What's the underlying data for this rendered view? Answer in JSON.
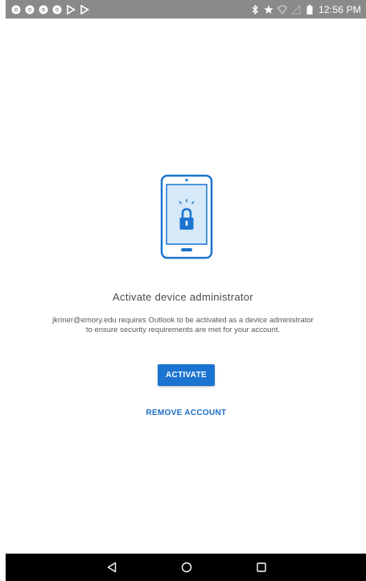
{
  "status_bar": {
    "time": "12:56 PM",
    "notification_icons": [
      "chrome-icon",
      "chrome-icon",
      "chrome-icon",
      "chrome-icon",
      "play-store-icon",
      "play-store-icon"
    ],
    "system_icons": [
      "bluetooth-icon",
      "star-icon",
      "wifi-icon",
      "signal-icon",
      "battery-icon"
    ]
  },
  "main": {
    "title": "Activate device administrator",
    "description_line1": "jkriner@emory.edu requires Outlook to be activated as a device administrator",
    "description_line2": "to ensure security requirements are met for your account.",
    "activate_label": "ACTIVATE",
    "remove_label": "REMOVE ACCOUNT"
  },
  "nav_bar": {
    "buttons": [
      "back-icon",
      "home-icon",
      "recents-icon"
    ]
  },
  "colors": {
    "accent": "#1c74d1",
    "status_bar": "#8a8a8a",
    "nav_bar": "#000000"
  }
}
